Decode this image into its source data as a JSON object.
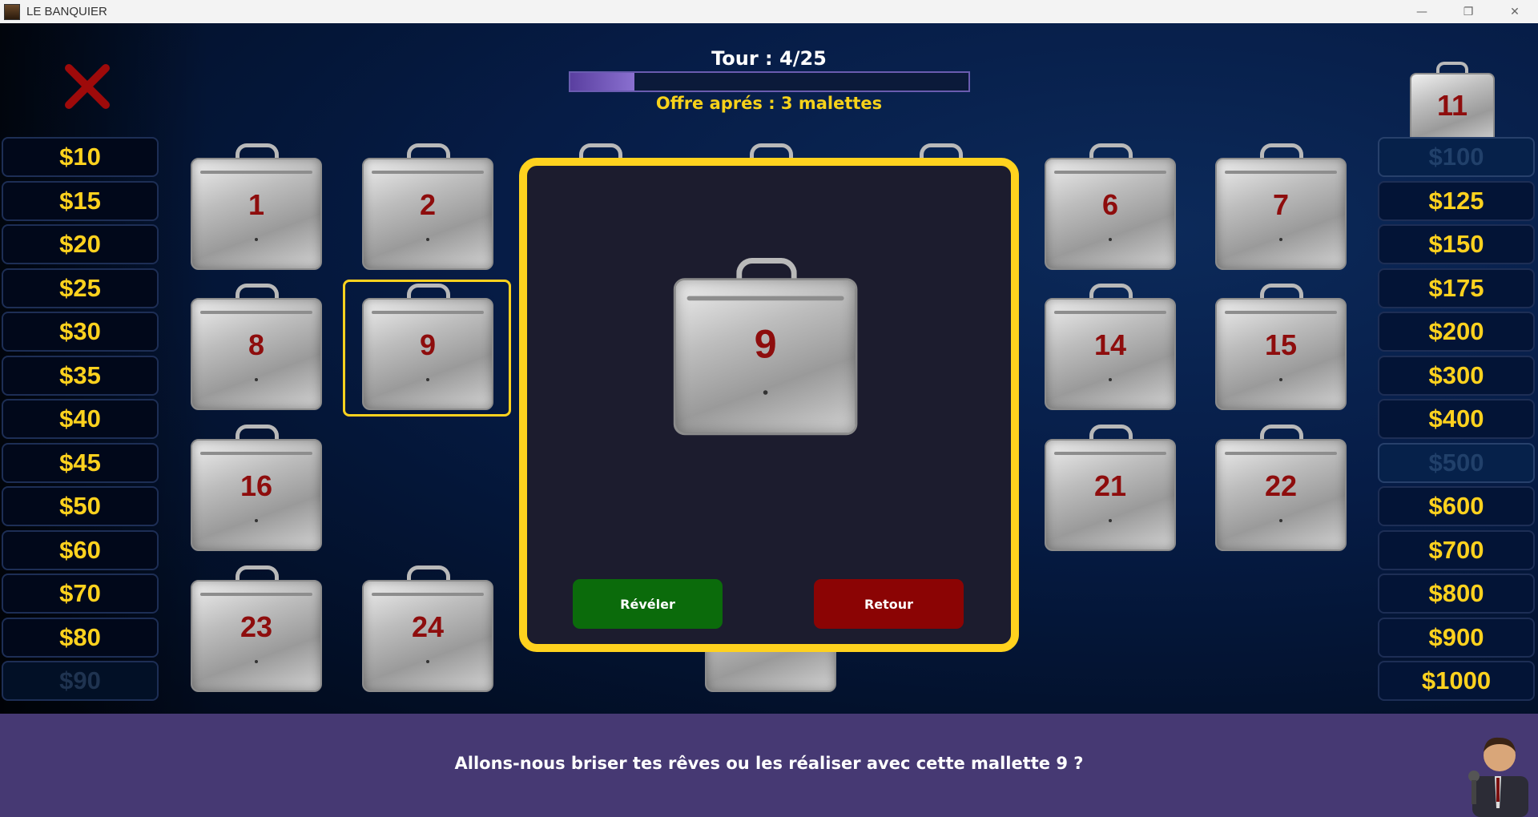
{
  "window": {
    "title": "LE BANQUIER",
    "minimize_glyph": "—",
    "restore_glyph": "❐",
    "close_glyph": "✕"
  },
  "header": {
    "tour": "Tour : 4/25",
    "progress_fraction": 0.16,
    "offer": "Offre aprés : 3 malettes"
  },
  "player_case": {
    "number": "11"
  },
  "left_values": [
    {
      "label": "$10",
      "eliminated": false
    },
    {
      "label": "$15",
      "eliminated": false
    },
    {
      "label": "$20",
      "eliminated": false
    },
    {
      "label": "$25",
      "eliminated": false
    },
    {
      "label": "$30",
      "eliminated": false
    },
    {
      "label": "$35",
      "eliminated": false
    },
    {
      "label": "$40",
      "eliminated": false
    },
    {
      "label": "$45",
      "eliminated": false
    },
    {
      "label": "$50",
      "eliminated": false
    },
    {
      "label": "$60",
      "eliminated": false
    },
    {
      "label": "$70",
      "eliminated": false
    },
    {
      "label": "$80",
      "eliminated": false
    },
    {
      "label": "$90",
      "eliminated": true
    }
  ],
  "right_values": [
    {
      "label": "$100",
      "eliminated": true
    },
    {
      "label": "$125",
      "eliminated": false
    },
    {
      "label": "$150",
      "eliminated": false
    },
    {
      "label": "$175",
      "eliminated": false
    },
    {
      "label": "$200",
      "eliminated": false
    },
    {
      "label": "$300",
      "eliminated": false
    },
    {
      "label": "$400",
      "eliminated": false
    },
    {
      "label": "$500",
      "eliminated": true
    },
    {
      "label": "$600",
      "eliminated": false
    },
    {
      "label": "$700",
      "eliminated": false
    },
    {
      "label": "$800",
      "eliminated": false
    },
    {
      "label": "$900",
      "eliminated": false
    },
    {
      "label": "$1000",
      "eliminated": false
    }
  ],
  "cases": [
    "1",
    "2",
    "6",
    "7",
    "8",
    "9",
    "14",
    "15",
    "16",
    "21",
    "22",
    "23",
    "24"
  ],
  "modal": {
    "case_number": "9",
    "reveal_label": "Révéler",
    "back_label": "Retour"
  },
  "footer": {
    "message": "Allons-nous briser tes rêves ou les réaliser avec cette mallette 9 ?"
  },
  "icons": {
    "quit": "close-x-icon",
    "host": "host-avatar"
  },
  "colors": {
    "gold": "#ffd21e",
    "case_number": "#8e0d0d",
    "reveal": "#0b6b0b",
    "back": "#8b0404",
    "footer": "#463973"
  }
}
